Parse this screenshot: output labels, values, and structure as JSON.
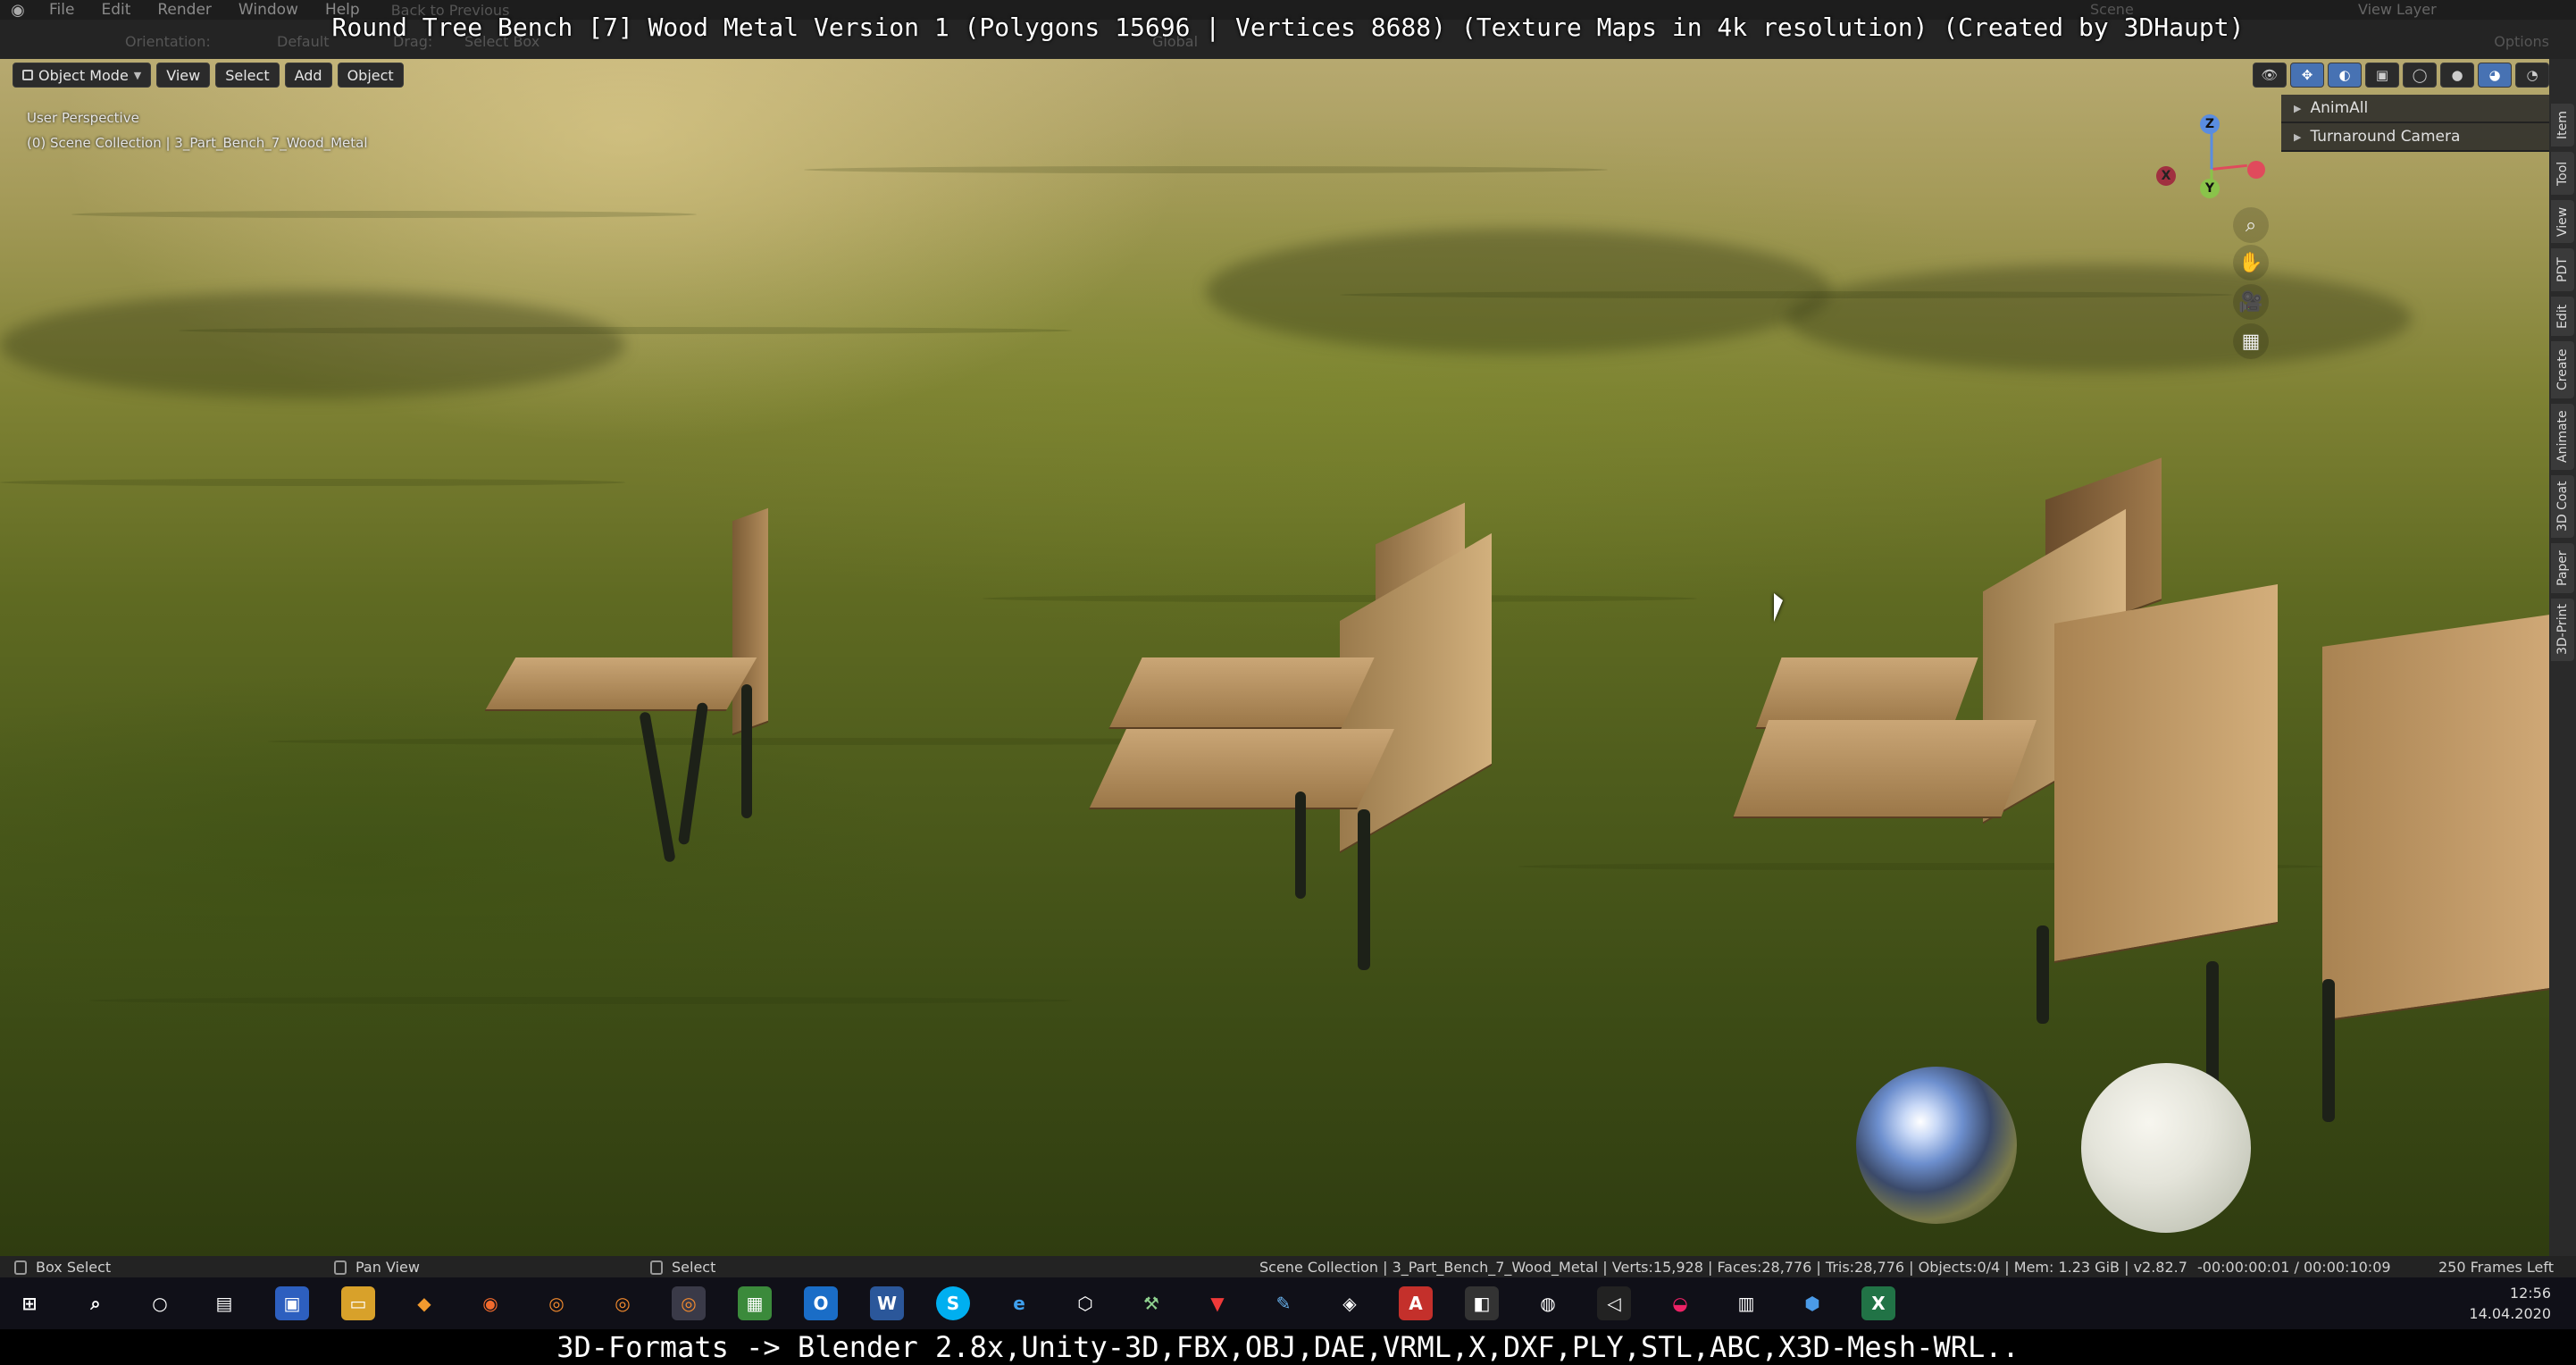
{
  "video_title": "Round Tree Bench [7] Wood Metal Version 1 (Polygons 15696 | Vertices 8688) (Texture Maps in 4k resolution) (Created by 3DHaupt)",
  "menubar": {
    "items": [
      "File",
      "Edit",
      "Render",
      "Window",
      "Help"
    ],
    "back_label": "Back to Previous",
    "scene_label": "Scene",
    "view_layer_label": "View Layer"
  },
  "tool_header": {
    "orientation_label": "Orientation:",
    "orientation_value": "Default",
    "drag_label": "Drag:",
    "drag_value": "Select Box",
    "transform_value": "Global",
    "options_label": "Options"
  },
  "viewport_header": {
    "mode": "Object Mode",
    "menus": [
      "View",
      "Select",
      "Add",
      "Object"
    ]
  },
  "viewport_info": {
    "perspective": "User Perspective",
    "collection": "(0) Scene Collection | 3_Part_Bench_7_Wood_Metal"
  },
  "gizmo": {
    "z": "Z",
    "y": "Y",
    "x": "X"
  },
  "npanel": {
    "items": [
      "AnimAll",
      "Turnaround Camera"
    ]
  },
  "side_tabs": [
    "Item",
    "Tool",
    "View",
    "PDT",
    "Edit",
    "Create",
    "Animate",
    "3D Coat",
    "Paper",
    "3D-Print"
  ],
  "statusbar": {
    "left": "Box Select",
    "middle": "Pan View",
    "right": "Select",
    "stats": "Scene Collection | 3_Part_Bench_7_Wood_Metal | Verts:15,928 | Faces:28,776 | Tris:28,776 | Objects:0/4 | Mem: 1.23 GiB | v2.82.7",
    "time": "-00:00:00:01 / 00:00:10:09",
    "frames": "250 Frames Left"
  },
  "taskbar": {
    "icons": [
      "windows-start",
      "search",
      "cortana",
      "task-view",
      "save",
      "file-explorer",
      "blender-flame",
      "firefox",
      "blender",
      "blender",
      "blender",
      "spreadsheet",
      "outlook",
      "word",
      "skype",
      "edge",
      "3d-box",
      "tool",
      "vivaldi",
      "paint",
      "unity",
      "acrobat",
      "visual-studio",
      "chrome-like",
      "vscode",
      "game",
      "calculator",
      "maps",
      "excel"
    ],
    "time": "12:56",
    "date": "14.04.2020"
  },
  "caption": "3D-Formats -> Blender 2.8x,Unity-3D,FBX,OBJ,DAE,VRML,X,DXF,PLY,STL,ABC,X3D-Mesh-WRL.."
}
